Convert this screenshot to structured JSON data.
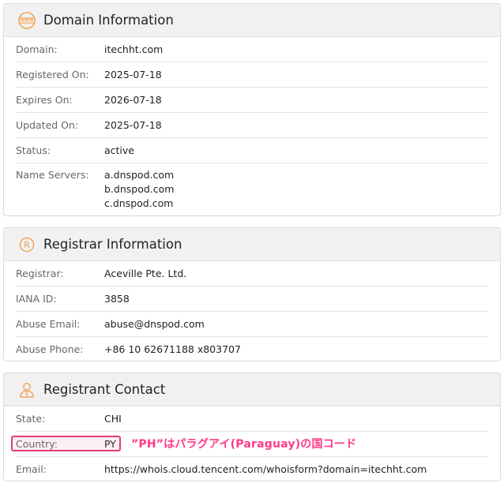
{
  "domain_card": {
    "title": "Domain Information",
    "icon": "www-globe-icon",
    "rows": [
      {
        "label": "Domain:",
        "value": "itechht.com"
      },
      {
        "label": "Registered On:",
        "value": "2025-07-18"
      },
      {
        "label": "Expires On:",
        "value": "2026-07-18"
      },
      {
        "label": "Updated On:",
        "value": "2025-07-18"
      },
      {
        "label": "Status:",
        "value": "active"
      },
      {
        "label": "Name Servers:",
        "values": [
          "a.dnspod.com",
          "b.dnspod.com",
          "c.dnspod.com"
        ]
      }
    ]
  },
  "registrar_card": {
    "title": "Registrar Information",
    "icon": "registered-mark-icon",
    "rows": [
      {
        "label": "Registrar:",
        "value": "Aceville Pte. Ltd."
      },
      {
        "label": "IANA ID:",
        "value": "3858"
      },
      {
        "label": "Abuse Email:",
        "value": "abuse@dnspod.com"
      },
      {
        "label": "Abuse Phone:",
        "value": "+86 10 62671188 x803707"
      }
    ]
  },
  "contact_card": {
    "title": "Registrant Contact",
    "icon": "person-icon",
    "rows": [
      {
        "label": "State:",
        "value": "CHI"
      },
      {
        "label": "Country:",
        "value": "PY"
      },
      {
        "label": "Email:",
        "value": "https://whois.cloud.tencent.com/whoisform?domain=itechht.com"
      }
    ]
  },
  "annotation": {
    "text": "”PH”はパラグアイ(Paraguay)の国コード",
    "color": "#ff3a86"
  },
  "colors": {
    "icon_orange": "#f0a35a",
    "header_bg": "#f1f1f1",
    "highlight_border": "#e23d7a"
  }
}
